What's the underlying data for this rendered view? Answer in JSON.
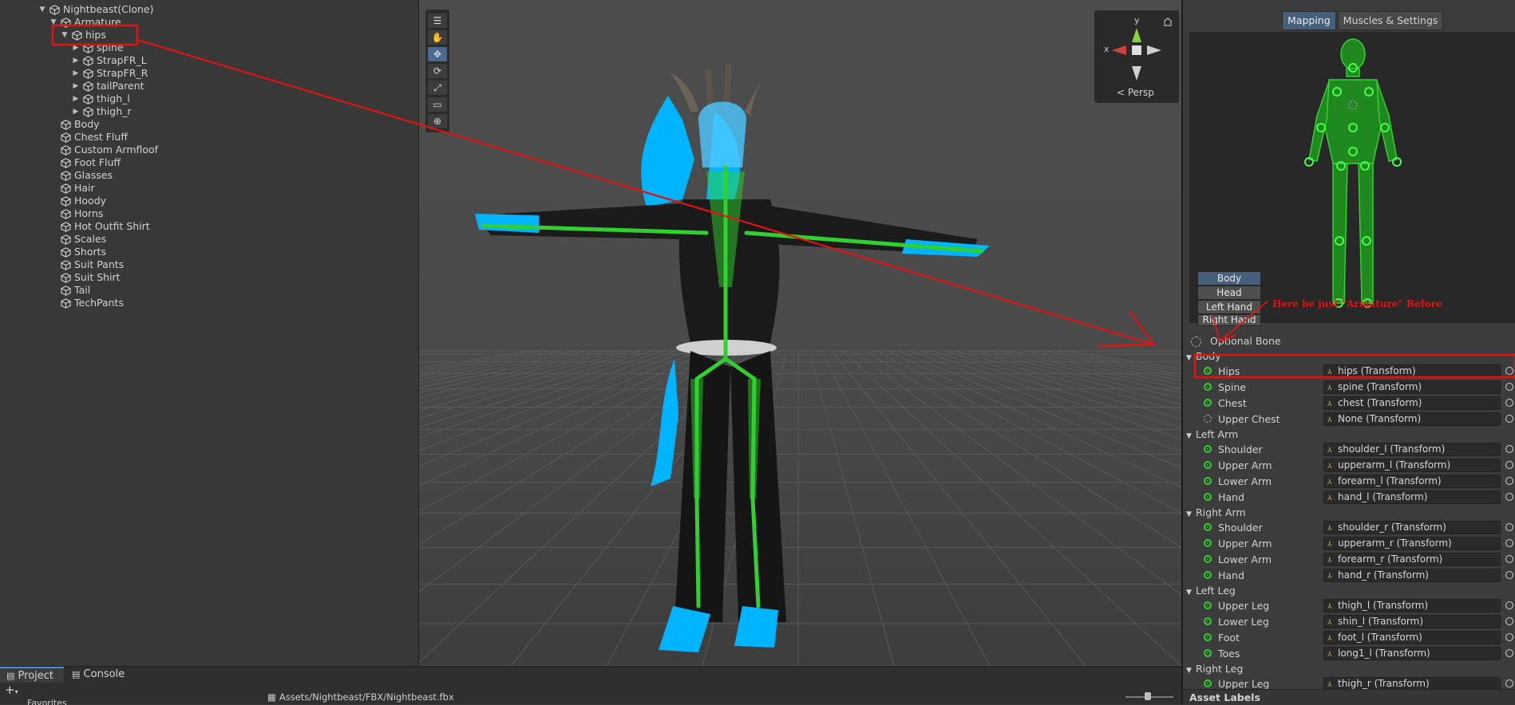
{
  "hierarchy": {
    "items": [
      {
        "label": "Nightbeast(Clone)",
        "indent": 0,
        "arrow": "down"
      },
      {
        "label": "Armature",
        "indent": 1,
        "arrow": "down"
      },
      {
        "label": "hips",
        "indent": 2,
        "arrow": "down"
      },
      {
        "label": "spine",
        "indent": 3,
        "arrow": "right"
      },
      {
        "label": "StrapFR_L",
        "indent": 3,
        "arrow": "right"
      },
      {
        "label": "StrapFR_R",
        "indent": 3,
        "arrow": "right"
      },
      {
        "label": "tailParent",
        "indent": 3,
        "arrow": "right"
      },
      {
        "label": "thigh_l",
        "indent": 3,
        "arrow": "right"
      },
      {
        "label": "thigh_r",
        "indent": 3,
        "arrow": "right"
      },
      {
        "label": "Body",
        "indent": 1,
        "arrow": ""
      },
      {
        "label": "Chest Fluff",
        "indent": 1,
        "arrow": ""
      },
      {
        "label": "Custom Armfloof",
        "indent": 1,
        "arrow": ""
      },
      {
        "label": "Foot Fluff",
        "indent": 1,
        "arrow": ""
      },
      {
        "label": "Glasses",
        "indent": 1,
        "arrow": ""
      },
      {
        "label": "Hair",
        "indent": 1,
        "arrow": ""
      },
      {
        "label": "Hoody",
        "indent": 1,
        "arrow": ""
      },
      {
        "label": "Horns",
        "indent": 1,
        "arrow": ""
      },
      {
        "label": "Hot Outfit Shirt",
        "indent": 1,
        "arrow": ""
      },
      {
        "label": "Scales",
        "indent": 1,
        "arrow": ""
      },
      {
        "label": "Shorts",
        "indent": 1,
        "arrow": ""
      },
      {
        "label": "Suit Pants",
        "indent": 1,
        "arrow": ""
      },
      {
        "label": "Suit Shirt",
        "indent": 1,
        "arrow": ""
      },
      {
        "label": "Tail",
        "indent": 1,
        "arrow": ""
      },
      {
        "label": "TechPants",
        "indent": 1,
        "arrow": ""
      }
    ]
  },
  "scene": {
    "gizmo": {
      "y_label": "y",
      "x_label": "x",
      "persp_label": "< Persp"
    }
  },
  "inspector": {
    "tabs": [
      {
        "label": "Mapping",
        "selected": true
      },
      {
        "label": "Muscles & Settings",
        "selected": false
      }
    ],
    "body_parts": [
      {
        "label": "Body",
        "selected": true
      },
      {
        "label": "Head",
        "selected": false
      },
      {
        "label": "Left Hand",
        "selected": false
      },
      {
        "label": "Right Hand",
        "selected": false
      }
    ],
    "annotation": "Here be just \"Armature\" Before",
    "optional_bone_label": "Optional Bone",
    "sections": [
      {
        "title": "Body",
        "rows": [
          {
            "label": "Hips",
            "value": "hips (Transform)",
            "optional": false
          },
          {
            "label": "Spine",
            "value": "spine (Transform)",
            "optional": false
          },
          {
            "label": "Chest",
            "value": "chest (Transform)",
            "optional": true
          },
          {
            "label": "Upper Chest",
            "value": "None (Transform)",
            "optional": true,
            "empty": true
          }
        ]
      },
      {
        "title": "Left Arm",
        "rows": [
          {
            "label": "Shoulder",
            "value": "shoulder_l (Transform)",
            "optional": false
          },
          {
            "label": "Upper Arm",
            "value": "upperarm_l (Transform)",
            "optional": false
          },
          {
            "label": "Lower Arm",
            "value": "forearm_l (Transform)",
            "optional": false
          },
          {
            "label": "Hand",
            "value": "hand_l (Transform)",
            "optional": false
          }
        ]
      },
      {
        "title": "Right Arm",
        "rows": [
          {
            "label": "Shoulder",
            "value": "shoulder_r (Transform)",
            "optional": true
          },
          {
            "label": "Upper Arm",
            "value": "upperarm_r (Transform)",
            "optional": false
          },
          {
            "label": "Lower Arm",
            "value": "forearm_r (Transform)",
            "optional": false
          },
          {
            "label": "Hand",
            "value": "hand_r (Transform)",
            "optional": false
          }
        ]
      },
      {
        "title": "Left Leg",
        "rows": [
          {
            "label": "Upper Leg",
            "value": "thigh_l (Transform)",
            "optional": false
          },
          {
            "label": "Lower Leg",
            "value": "shin_l (Transform)",
            "optional": false
          },
          {
            "label": "Foot",
            "value": "foot_l (Transform)",
            "optional": false
          },
          {
            "label": "Toes",
            "value": "long1_l (Transform)",
            "optional": true
          }
        ]
      },
      {
        "title": "Right Leg",
        "rows": [
          {
            "label": "Upper Leg",
            "value": "thigh_r (Transform)",
            "optional": false
          }
        ]
      }
    ],
    "asset_labels": "Asset Labels"
  },
  "project": {
    "tabs": [
      {
        "label": "Project",
        "selected": true
      },
      {
        "label": "Console",
        "selected": false
      }
    ],
    "path": "Assets/Nightbeast/FBX/Nightbeast.fbx",
    "favorites": "Favorites"
  },
  "colors": {
    "accent": "#46607c",
    "bone_green": "#2fd02f",
    "annotation_red": "#e31212",
    "highlight": "#00b4ff"
  }
}
